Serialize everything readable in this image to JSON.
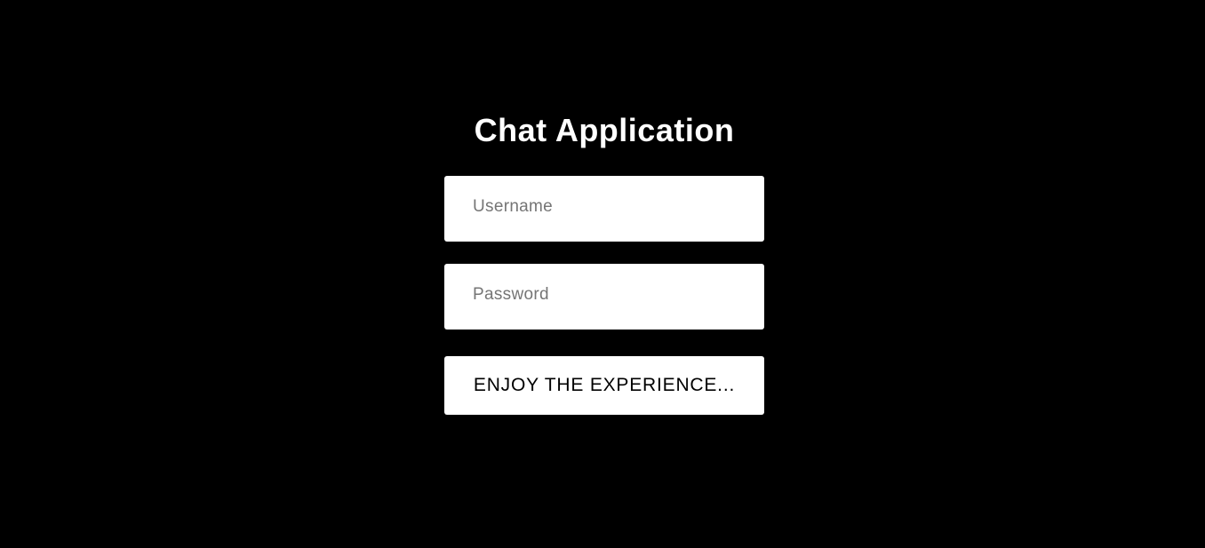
{
  "app": {
    "title": "Chat Application"
  },
  "form": {
    "username_placeholder": "Username",
    "username_value": "",
    "password_placeholder": "Password",
    "password_value": "",
    "submit_label": "ENJOY THE EXPERIENCE..."
  },
  "colors": {
    "background": "#000000",
    "card_fields": "#ffffff",
    "title_text": "#ffffff",
    "placeholder_text": "#757575",
    "button_text": "#000000"
  }
}
